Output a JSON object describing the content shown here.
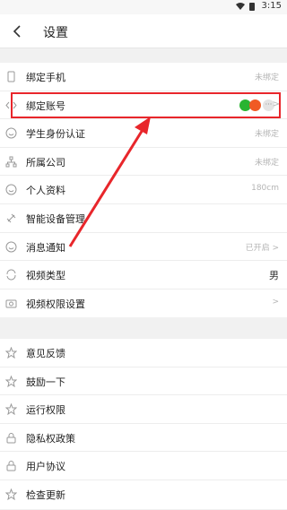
{
  "status": {
    "time": "3:15"
  },
  "header": {
    "title": "设置"
  },
  "group1": [
    {
      "label": "绑定手机",
      "value": "未绑定",
      "icon": "phone-icon"
    },
    {
      "label": "绑定账号",
      "value": "",
      "icon": "link-icon",
      "accounts": [
        "wechat-icon",
        "taobao-icon",
        "more-icon"
      ],
      "chevron": ">"
    },
    {
      "label": "学生身份认证",
      "value": "未绑定",
      "icon": "smile-icon"
    },
    {
      "label": "所属公司",
      "value": "未绑定",
      "icon": "org-icon"
    },
    {
      "label": "个人资料",
      "value": "180cm",
      "icon": "smile-icon"
    },
    {
      "label": "智能设备管理",
      "value": "",
      "icon": "device-icon"
    },
    {
      "label": "消息通知",
      "value": "已开启 >",
      "icon": "smile-icon"
    },
    {
      "label": "视频类型",
      "value": "男",
      "icon": "refresh-icon"
    },
    {
      "label": "视频权限设置",
      "value": ">",
      "icon": "camera-icon"
    }
  ],
  "group2": [
    {
      "label": "意见反馈",
      "icon": "star-icon"
    },
    {
      "label": "鼓励一下",
      "icon": "star-icon"
    },
    {
      "label": "运行权限",
      "icon": "star-icon"
    },
    {
      "label": "隐私权政策",
      "icon": "lock-icon"
    },
    {
      "label": "用户协议",
      "icon": "lock-icon"
    },
    {
      "label": "检查更新",
      "icon": "star-icon"
    }
  ],
  "colors": {
    "highlight": "#e8262b",
    "wechat": "#29b431",
    "taobao": "#f05a24"
  }
}
